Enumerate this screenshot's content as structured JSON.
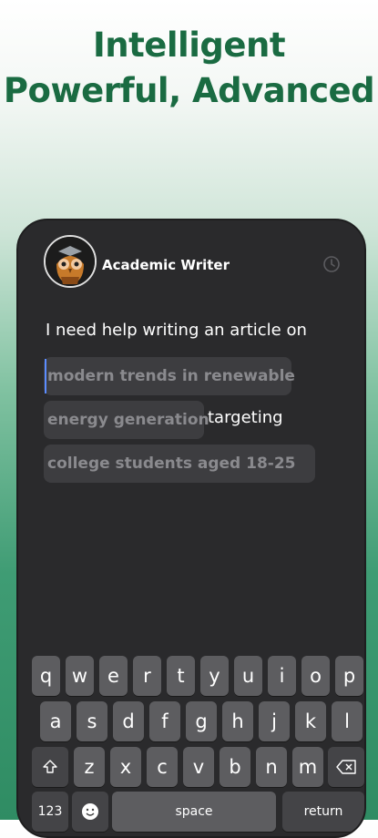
{
  "promo": {
    "line1": "Intelligent",
    "line2": "Powerful, Advanced"
  },
  "header": {
    "title": "Academic Writer",
    "avatar_icon": "owl-avatar-icon",
    "history_icon": "clock-history-icon"
  },
  "prompt": {
    "intro": "I need help writing an article on",
    "topic_line1": "modern trends in renewable",
    "topic_line2": "energy generation",
    "connector": "targeting",
    "audience": "college students aged 18-25"
  },
  "keyboard": {
    "row1": [
      "q",
      "w",
      "e",
      "r",
      "t",
      "y",
      "u",
      "i",
      "o",
      "p"
    ],
    "row2": [
      "a",
      "s",
      "d",
      "f",
      "g",
      "h",
      "j",
      "k",
      "l"
    ],
    "row3": [
      "z",
      "x",
      "c",
      "v",
      "b",
      "n",
      "m"
    ],
    "shift_icon": "shift-icon",
    "delete_icon": "backspace-icon",
    "numbers_label": "123",
    "emoji_icon": "emoji-icon",
    "space_label": "space",
    "return_label": "return"
  },
  "colors": {
    "headline": "#1a6b42",
    "phone_bg": "#2a2a2c",
    "chip_bg": "#3d3d40",
    "cursor": "#5b8cff"
  }
}
